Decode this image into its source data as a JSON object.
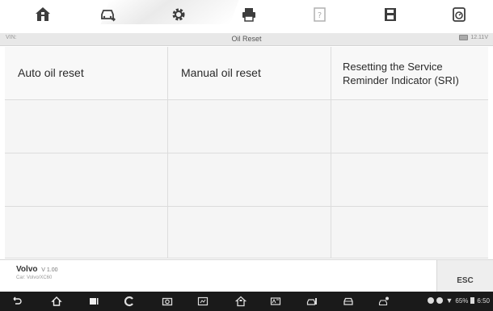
{
  "toolbar": {
    "items": [
      {
        "name": "home",
        "icon": "home-icon"
      },
      {
        "name": "vehicle-swap",
        "icon": "vehicle-swap-icon"
      },
      {
        "name": "settings",
        "icon": "gear-icon"
      },
      {
        "name": "print",
        "icon": "printer-icon"
      },
      {
        "name": "help",
        "icon": "help-icon"
      },
      {
        "name": "save",
        "icon": "save-icon"
      },
      {
        "name": "data-logging",
        "icon": "data-logging-icon"
      }
    ]
  },
  "infobar": {
    "vin_label": "VIN:",
    "title": "Oil Reset",
    "battery_voltage": "12.11V"
  },
  "grid": {
    "cells": [
      [
        "Auto oil reset",
        "Manual oil reset",
        "Resetting the Service Reminder Indicator (SRI)"
      ],
      [
        "",
        "",
        ""
      ],
      [
        "",
        "",
        ""
      ],
      [
        "",
        "",
        ""
      ]
    ]
  },
  "footer": {
    "brand": "Volvo",
    "version": "V 1.00",
    "car": "Car: Volvo/XC60",
    "esc_label": "ESC"
  },
  "navbar": {
    "status_battery": "65%",
    "status_time": "6:50"
  },
  "colors": {
    "toolbar_icon": "#444444",
    "infobar_bg": "#e8e8e8",
    "grid_bg": "#f5f5f5",
    "navbar_bg": "#1a1a1a"
  }
}
